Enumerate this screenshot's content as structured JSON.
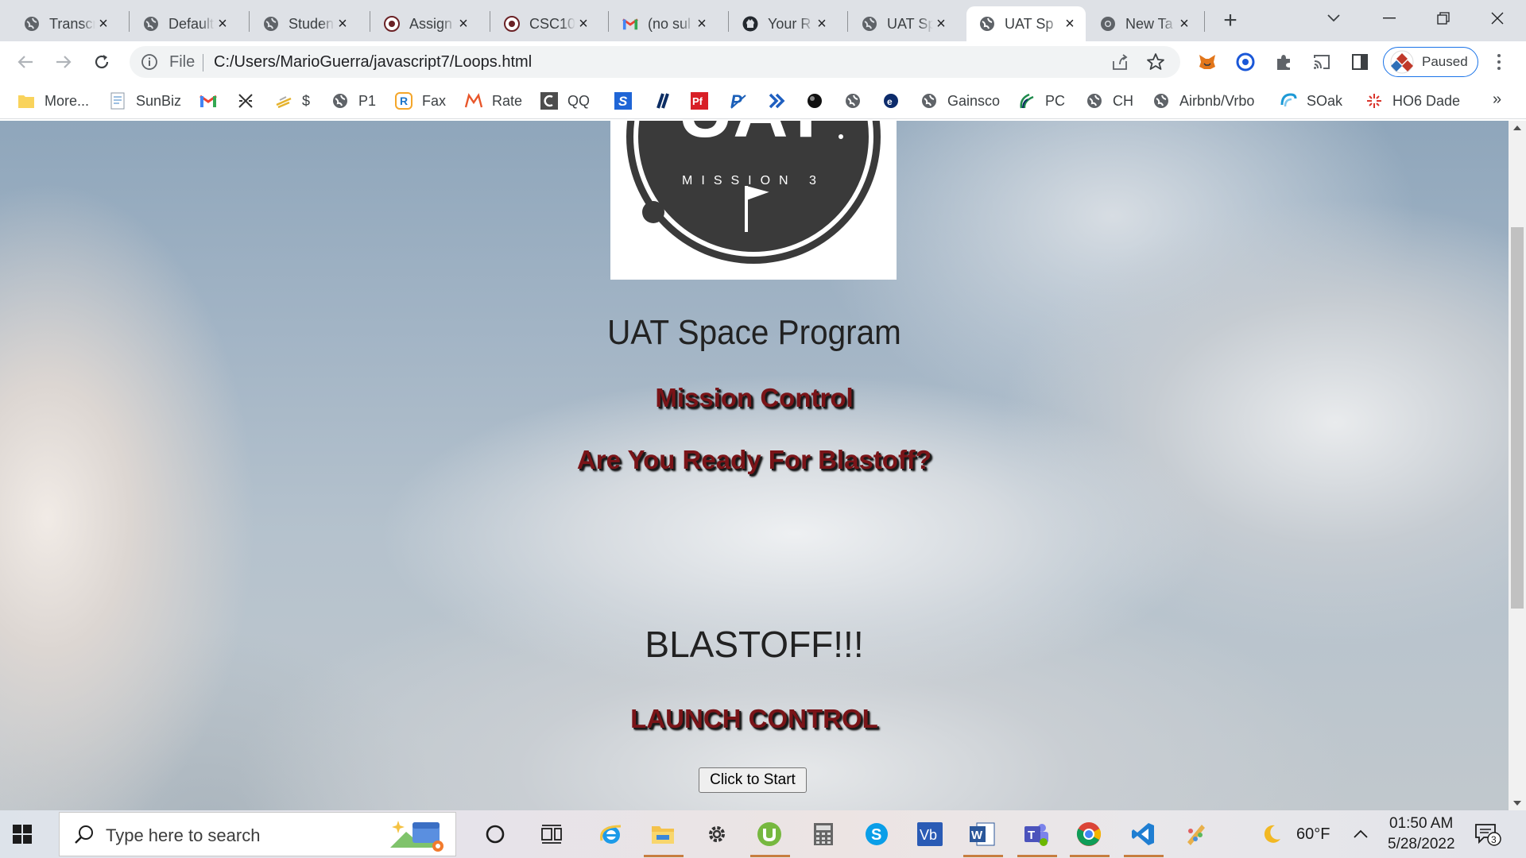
{
  "browser": {
    "tabs": [
      {
        "title": "Transcr",
        "icon": "globe-icon",
        "active": false
      },
      {
        "title": "Default",
        "icon": "globe-icon",
        "active": false
      },
      {
        "title": "Student",
        "icon": "globe-icon",
        "active": false
      },
      {
        "title": "Assign",
        "icon": "uat-badge-icon",
        "active": false
      },
      {
        "title": "CSC10",
        "icon": "uat-badge-icon",
        "active": false
      },
      {
        "title": "(no sul",
        "icon": "gmail-icon",
        "active": false
      },
      {
        "title": "Your R",
        "icon": "github-icon",
        "active": false
      },
      {
        "title": "UAT Sp",
        "icon": "globe-icon",
        "active": false
      },
      {
        "title": "UAT Sp",
        "icon": "globe-icon",
        "active": true
      },
      {
        "title": "New Ta",
        "icon": "chrome-icon",
        "active": false
      }
    ],
    "new_tab_symbol": "+",
    "omnibox": {
      "scheme_label": "File",
      "url": "C:/Users/MarioGuerra/javascript7/Loops.html"
    },
    "profile": {
      "label": "Paused"
    },
    "bookmarks": [
      {
        "label": "More...",
        "icon": "folder-icon"
      },
      {
        "label": "SunBiz",
        "icon": "document-icon"
      },
      {
        "label": "",
        "icon": "gmail-icon"
      },
      {
        "label": "",
        "icon": "crossed-tools-icon"
      },
      {
        "label": "$",
        "icon": "coin-icon"
      },
      {
        "label": "P1",
        "icon": "globe-icon"
      },
      {
        "label": "Fax",
        "icon": "r-badge-icon"
      },
      {
        "label": "Rate",
        "icon": "rate-logo-icon"
      },
      {
        "label": "QQ",
        "icon": "c-logo-icon"
      },
      {
        "label": "",
        "icon": "s-logo-icon"
      },
      {
        "label": "",
        "icon": "stripes-logo-icon"
      },
      {
        "label": "",
        "icon": "pf-logo-icon"
      },
      {
        "label": "",
        "icon": "p-logo-icon"
      },
      {
        "label": "",
        "icon": "arrow-logo-icon"
      },
      {
        "label": "",
        "icon": "ball-icon"
      },
      {
        "label": "",
        "icon": "globe-icon"
      },
      {
        "label": "",
        "icon": "e-logo-icon"
      },
      {
        "label": "Gainsco",
        "icon": "globe-icon"
      },
      {
        "label": "PC",
        "icon": "leaf-logo-icon"
      },
      {
        "label": "CH",
        "icon": "globe-icon"
      },
      {
        "label": "Airbnb/Vrbo",
        "icon": "globe-icon"
      },
      {
        "label": "SOak",
        "icon": "swirl-logo-icon"
      },
      {
        "label": "HO6 Dade",
        "icon": "sparkle-logo-icon"
      }
    ],
    "bookmarks_overflow": "»"
  },
  "page": {
    "logo_text": {
      "big": "UAT",
      "mission": "MISSION 3"
    },
    "title": "UAT Space Program",
    "subtitle_1": "Mission Control",
    "subtitle_2": "Are You Ready For Blastoff?",
    "blastoff": "BLASTOFF!!!",
    "launch_control": "LAUNCH CONTROL",
    "start_button": "Click to Start"
  },
  "taskbar": {
    "search_placeholder": "Type here to search",
    "pinned_apps": [
      "cortana-icon",
      "task-view-icon",
      "internet-explorer-icon",
      "file-explorer-icon",
      "settings-icon",
      "utorrent-icon",
      "calculator-icon",
      "skype-icon",
      "visio-icon",
      "word-icon",
      "teams-icon",
      "chrome-icon",
      "vscode-icon",
      "paint-icon"
    ],
    "weather": {
      "temperature": "60°F",
      "icon": "moon-icon"
    },
    "clock": {
      "time": "01:50 AM",
      "date": "5/28/2022"
    },
    "notifications_count": "3"
  },
  "colors": {
    "tabstrip_bg": "#dee1e6",
    "accent_blue": "#1a73e8",
    "heading_red": "#7a1418"
  }
}
